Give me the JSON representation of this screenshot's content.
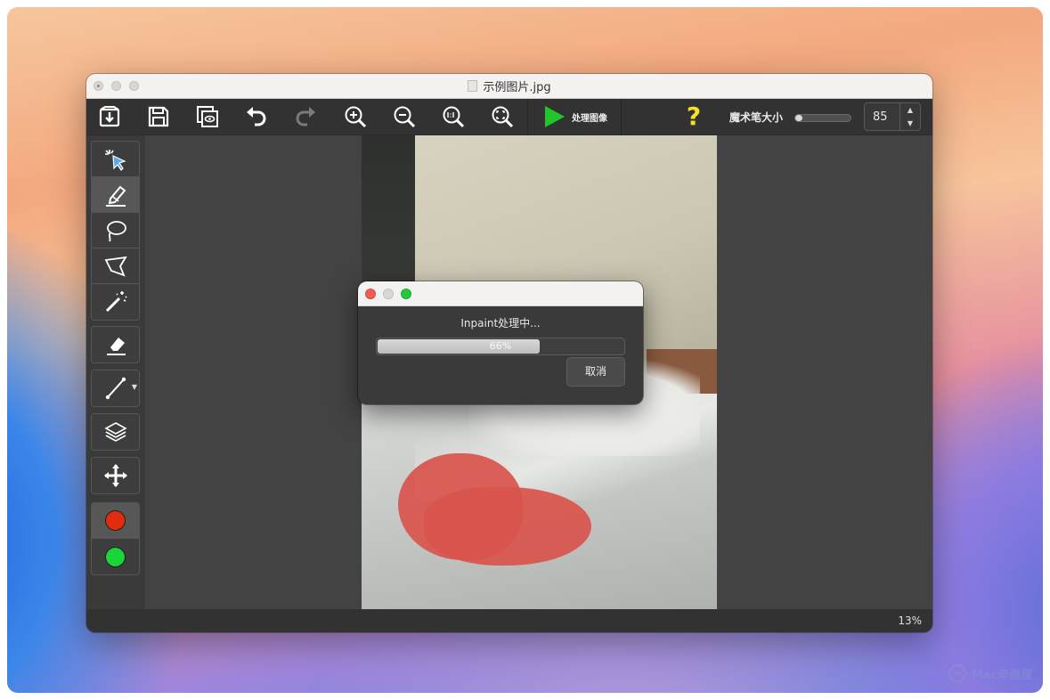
{
  "window": {
    "title": "示例图片.jpg"
  },
  "toolbar": {
    "process_label": "处理图像",
    "help_label": "?",
    "brush_size_label": "魔术笔大小",
    "brush_size_value": "85",
    "brush_slider_level": 0.12,
    "stepper_up": "▲",
    "stepper_down": "▼",
    "icons": [
      "import-icon",
      "save-icon",
      "compare-icon",
      "undo-icon",
      "redo-icon",
      "zoom-in-icon",
      "zoom-out-icon",
      "zoom-actual-icon",
      "zoom-fit-icon",
      "play-icon"
    ]
  },
  "sidebar": {
    "tools": [
      "select-pointer-icon",
      "brush-pen-icon",
      "lasso-icon",
      "polygon-lasso-icon",
      "magic-wand-icon",
      "eraser-icon",
      "line-icon",
      "layers-icon",
      "move-icon"
    ],
    "active_tool": "brush-pen-icon",
    "mask_colors": [
      "#e32b0d",
      "#1bd43a"
    ]
  },
  "statusbar": {
    "zoom": "13%"
  },
  "dialog": {
    "message": "Inpaint处理中...",
    "progress_text": "66%",
    "progress_value": 0.66,
    "cancel_label": "取消"
  },
  "watermark": {
    "text": "Mac奇趣屋"
  },
  "colors": {
    "accent_green": "#22c52b",
    "help_yellow": "#f5e02a",
    "mask_red": "#d9544c"
  }
}
